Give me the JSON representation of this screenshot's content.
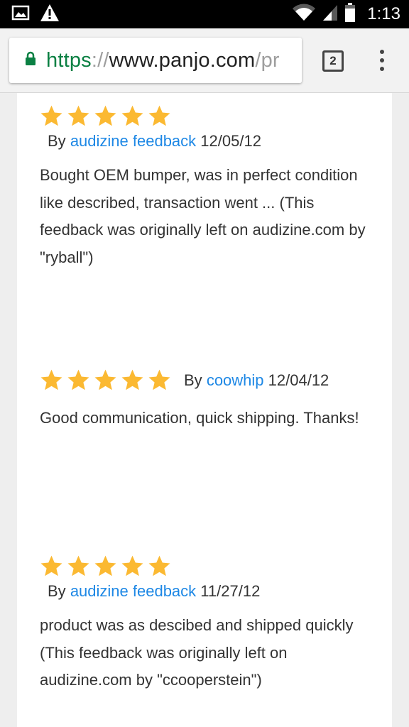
{
  "status_bar": {
    "left_icons": [
      "image-icon",
      "warning-icon"
    ],
    "right_icons": [
      "wifi-icon",
      "signal-icon",
      "battery-icon"
    ],
    "time": "1:13"
  },
  "browser": {
    "url": {
      "scheme": "https",
      "separator": "://",
      "host": "www.panjo.com",
      "path": "/pr"
    },
    "tab_count": "2",
    "menu_icon": "more-vert-icon",
    "lock_icon": "lock-icon",
    "colors": {
      "scheme": "#0b8043",
      "link": "#1e88e5",
      "star": "#fbb932"
    }
  },
  "reviews": [
    {
      "rating": 5,
      "by": "By",
      "user": "audizine feedback",
      "date": "12/05/12",
      "text": "Bought OEM bumper, was in perfect condition like described, transaction went ... (This feedback was originally left on audizine.com by \"ryball\")"
    },
    {
      "rating": 5,
      "by": "By",
      "user": "coowhip",
      "date": "12/04/12",
      "text": "Good communication, quick shipping. Thanks!"
    },
    {
      "rating": 5,
      "by": "By",
      "user": "audizine feedback",
      "date": "11/27/12",
      "text": "product was as descibed and shipped quickly (This feedback was originally left on audizine.com by \"ccooperstein\")"
    }
  ]
}
